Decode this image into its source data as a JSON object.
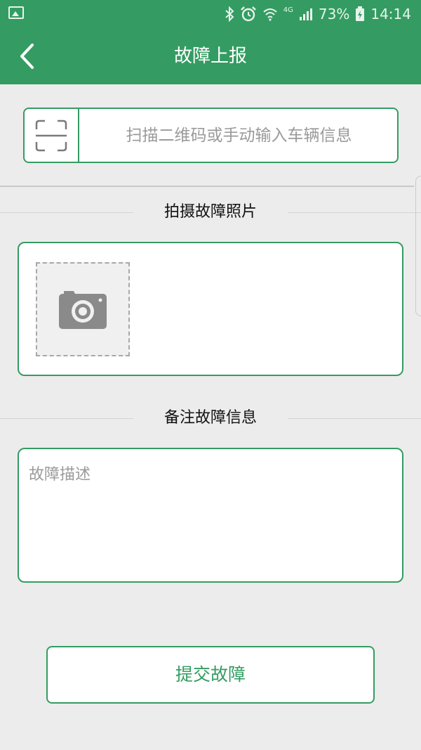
{
  "status_bar": {
    "network": "4G",
    "battery": "73%",
    "time": "14:14"
  },
  "nav": {
    "title": "故障上报",
    "back_icon": "chevron-left-icon"
  },
  "scan": {
    "icon": "scan-frame-icon",
    "placeholder": "扫描二维码或手动输入车辆信息",
    "value": ""
  },
  "photo_section": {
    "title": "拍摄故障照片",
    "add_icon": "camera-icon"
  },
  "remark_section": {
    "title": "备注故障信息",
    "placeholder": "故障描述",
    "value": ""
  },
  "submit": {
    "label": "提交故障"
  },
  "colors": {
    "brand": "#349c62",
    "background": "#ececec"
  }
}
